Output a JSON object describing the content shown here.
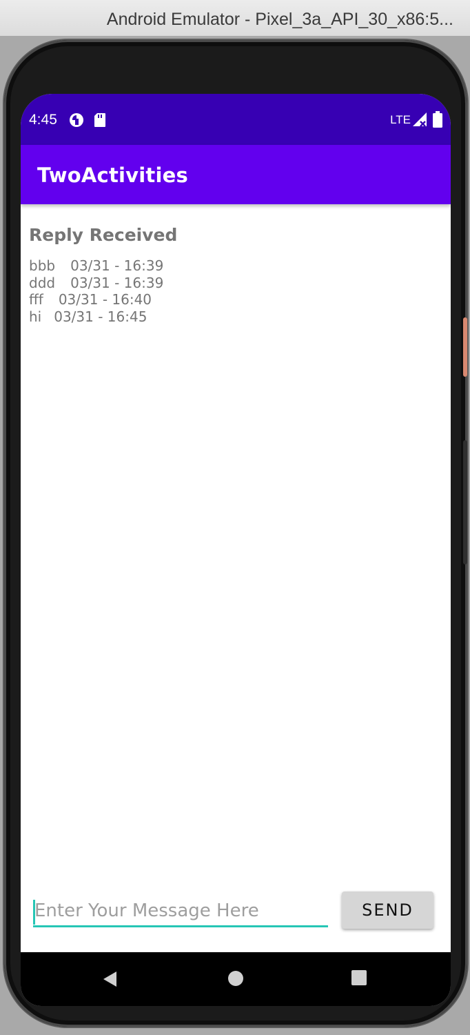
{
  "window": {
    "title": "Android Emulator - Pixel_3a_API_30_x86:5..."
  },
  "status_bar": {
    "time": "4:45",
    "network": "LTE",
    "icons": [
      "data-saver-icon",
      "sd-card-icon",
      "signal-icon",
      "battery-icon"
    ]
  },
  "app_bar": {
    "title": "TwoActivities",
    "color": "#6200ee",
    "status_color": "#3700b3"
  },
  "content": {
    "reply_header": "Reply Received",
    "replies": [
      {
        "text": "bbb",
        "time": "03/31 - 16:39"
      },
      {
        "text": "ddd",
        "time": "03/31 - 16:39"
      },
      {
        "text": "fff",
        "time": "03/31 - 16:40"
      },
      {
        "text": "hi",
        "time": "03/31 - 16:45"
      }
    ]
  },
  "composer": {
    "placeholder": "Enter Your Message Here",
    "value": "",
    "send_label": "SEND",
    "accent": "#26c6b5"
  },
  "nav_bar": {
    "icons": [
      "back-icon",
      "home-icon",
      "recents-icon"
    ]
  }
}
